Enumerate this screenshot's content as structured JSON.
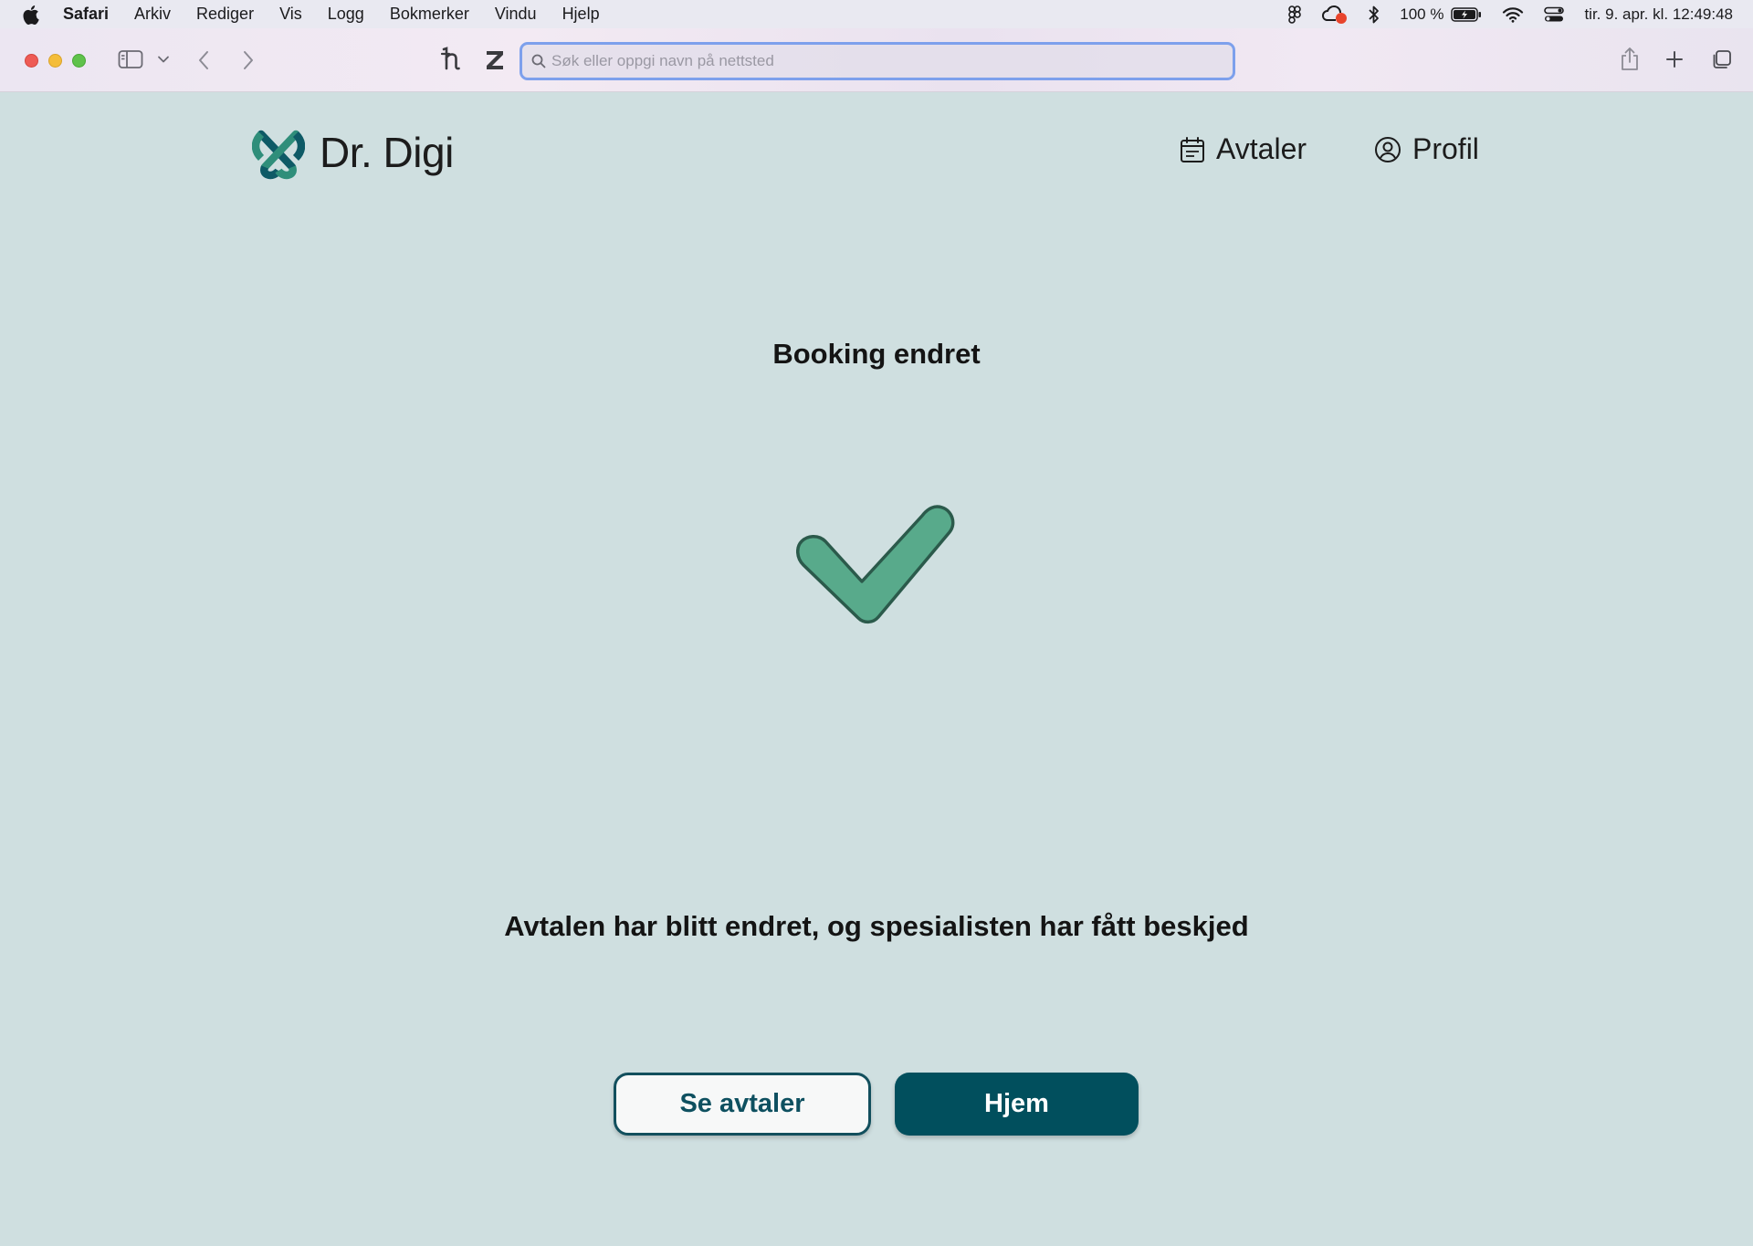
{
  "menubar": {
    "app_name": "Safari",
    "items": [
      "Arkiv",
      "Rediger",
      "Vis",
      "Logg",
      "Bokmerker",
      "Vindu",
      "Hjelp"
    ],
    "battery": "100 %",
    "datetime": "tir. 9. apr. kl. 12:49:48"
  },
  "browser": {
    "address_placeholder": "Søk eller oppgi navn på nettsted"
  },
  "app": {
    "brand": "Dr. Digi",
    "nav": {
      "appointments": "Avtaler",
      "profile": "Profil"
    }
  },
  "content": {
    "title": "Booking endret",
    "message": "Avtalen har blitt endret, og spesialisten har fått beskjed",
    "buttons": {
      "see_appointments": "Se avtaler",
      "home": "Hjem"
    }
  },
  "colors": {
    "background": "#cfdfe0",
    "primary": "#014f5d",
    "check_fill": "#58aa8b",
    "check_stroke": "#2b5a4b",
    "logo_teal": "#2f8e7a",
    "logo_dark": "#0e5a66"
  }
}
